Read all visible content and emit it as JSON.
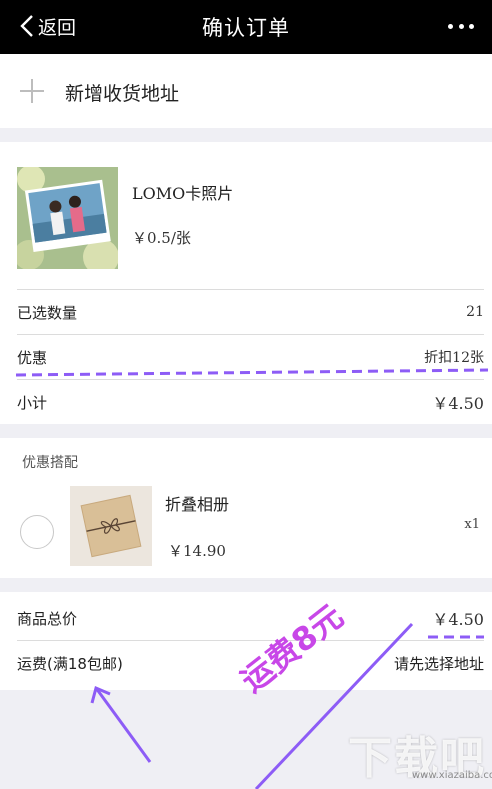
{
  "nav": {
    "back_label": "返回",
    "title": "确认订单",
    "more_icon": "more-dots-icon"
  },
  "address": {
    "add_label": "新增收货地址",
    "icon": "plus-icon"
  },
  "product": {
    "name": "LOMO卡照片",
    "price": "￥0.5/张",
    "rows": [
      {
        "label": "已选数量",
        "value": "21"
      },
      {
        "label": "优惠",
        "value": "折扣12张"
      },
      {
        "label": "小计",
        "value": "￥4.50"
      }
    ]
  },
  "combo": {
    "title": "优惠搭配",
    "item_name": "折叠相册",
    "item_price": "￥14.90",
    "qty": "x1",
    "selected": false
  },
  "totals": {
    "total_label": "商品总价",
    "total_value": "￥4.50",
    "shipping_label": "运费(满18包邮)",
    "shipping_hint": "请先选择地址"
  },
  "annotation": {
    "text": "运费8元",
    "color": "#c847e8",
    "line_color": "#9b5cf6"
  },
  "watermark": {
    "text": "下载吧",
    "url": "www.xiazaiba.com"
  },
  "colors": {
    "nav_bg": "#000000",
    "page_bg": "#efeff4",
    "card_bg": "#ffffff"
  }
}
